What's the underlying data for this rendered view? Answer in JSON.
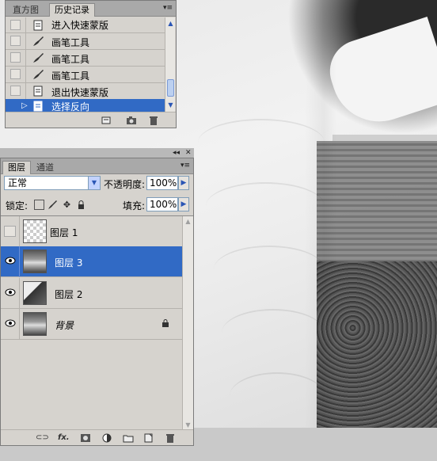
{
  "history_panel": {
    "tabs": [
      "直方图",
      "历史记录"
    ],
    "active_tab": 1,
    "items": [
      {
        "label": "进入快速蒙版",
        "icon": "document-icon"
      },
      {
        "label": "画笔工具",
        "icon": "brush-icon"
      },
      {
        "label": "画笔工具",
        "icon": "brush-icon"
      },
      {
        "label": "画笔工具",
        "icon": "brush-icon"
      },
      {
        "label": "退出快速蒙版",
        "icon": "document-icon"
      },
      {
        "label": "选择反向",
        "icon": "document-icon"
      }
    ],
    "selected_index": 5,
    "footer_buttons": [
      "new-document-from-state-icon",
      "snapshot-camera-icon",
      "trash-icon"
    ]
  },
  "layers_panel": {
    "tabs": [
      "图层",
      "通道"
    ],
    "active_tab": 0,
    "blend_mode": "正常",
    "opacity_label": "不透明度:",
    "opacity_value": "100%",
    "lock_label": "锁定:",
    "fill_label": "填充:",
    "fill_value": "100%",
    "layers": [
      {
        "name": "图层 1",
        "visible": false,
        "thumb": "transparent",
        "locked": false
      },
      {
        "name": "图层 3",
        "visible": true,
        "thumb": "photo",
        "locked": false
      },
      {
        "name": "图层 2",
        "visible": true,
        "thumb": "mask",
        "locked": false
      },
      {
        "name": "背景",
        "visible": true,
        "thumb": "photo",
        "locked": true
      }
    ],
    "selected_index": 1,
    "footer_buttons": [
      "link-icon",
      "fx-icon",
      "add-mask-icon",
      "adjustment-icon",
      "new-group-icon",
      "new-layer-icon",
      "trash-icon"
    ],
    "footer_fx": "fx."
  }
}
